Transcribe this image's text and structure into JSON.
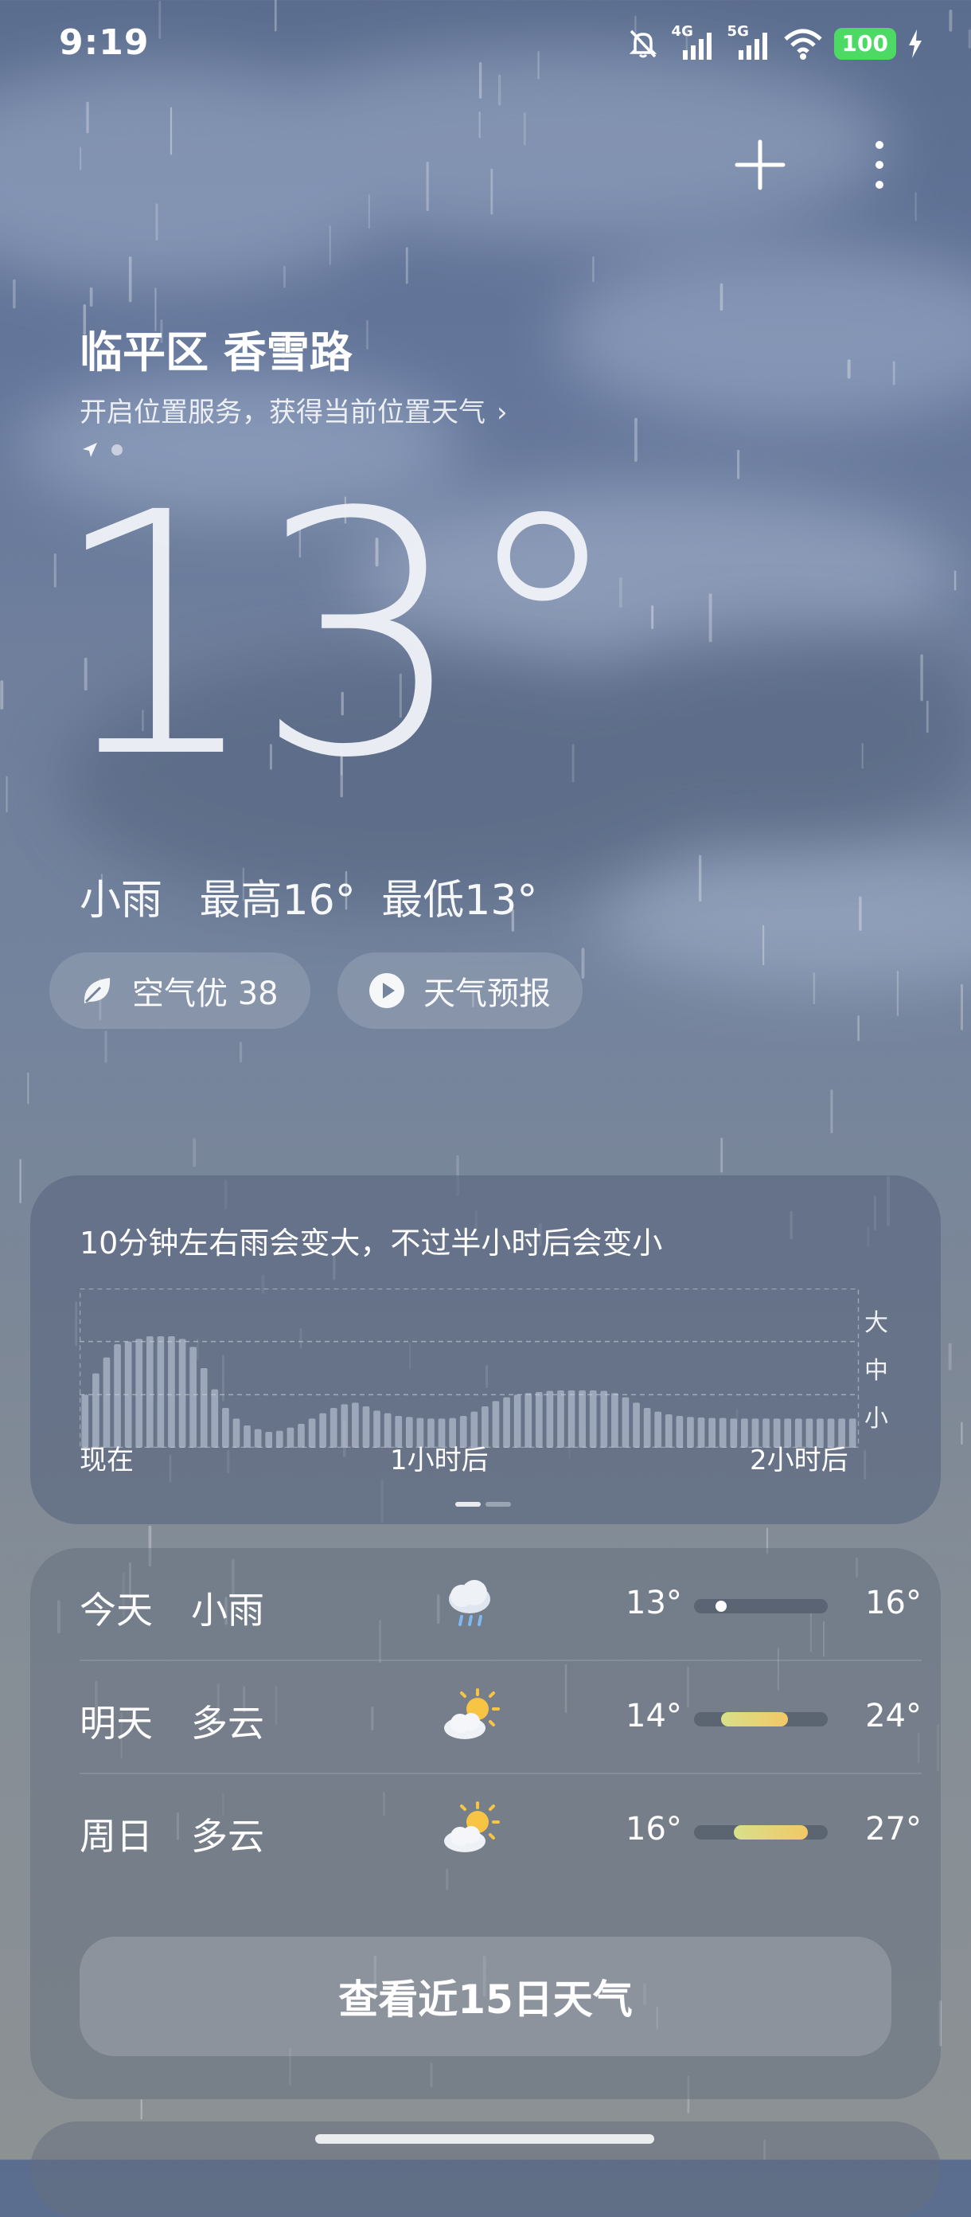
{
  "status_bar": {
    "time": "9:19",
    "net1": "4G",
    "net2": "5G",
    "battery": "100",
    "icons": [
      "mute-icon",
      "signal-icon",
      "wifi-icon",
      "battery-icon",
      "charging-icon"
    ]
  },
  "header": {
    "location": "临平区 香雪路",
    "location_hint": "开启位置服务，获得当前位置天气",
    "actions": [
      "add-city-icon",
      "more-icon"
    ]
  },
  "current": {
    "temperature": "13°",
    "condition": "小雨",
    "high": "最高16°",
    "low": "最低13°"
  },
  "pills": {
    "air": "空气优 38",
    "forecast": "天气预报"
  },
  "minute_rain": {
    "summary": "10分钟左右雨会变大，不过半小时后会变小",
    "x_labels": [
      "现在",
      "1小时后",
      "2小时后"
    ],
    "levels": [
      "大",
      "中",
      "小"
    ]
  },
  "chart_data": {
    "type": "bar",
    "ylim": [
      0,
      3
    ],
    "values": [
      1.0,
      1.4,
      1.7,
      1.95,
      2.0,
      2.05,
      2.1,
      2.1,
      2.1,
      2.05,
      1.9,
      1.5,
      1.1,
      0.75,
      0.55,
      0.42,
      0.35,
      0.3,
      0.32,
      0.38,
      0.45,
      0.55,
      0.65,
      0.75,
      0.82,
      0.85,
      0.78,
      0.7,
      0.65,
      0.6,
      0.58,
      0.56,
      0.55,
      0.55,
      0.56,
      0.6,
      0.68,
      0.78,
      0.88,
      0.95,
      1.0,
      1.03,
      1.05,
      1.07,
      1.08,
      1.08,
      1.08,
      1.08,
      1.07,
      1.03,
      0.95,
      0.85,
      0.75,
      0.68,
      0.63,
      0.6,
      0.58,
      0.57,
      0.56,
      0.56,
      0.55,
      0.55,
      0.55,
      0.55,
      0.55,
      0.55,
      0.55,
      0.55,
      0.55,
      0.55,
      0.55,
      0.55
    ]
  },
  "daily": [
    {
      "day": "今天",
      "condition": "小雨",
      "icon": "rain-cloud-icon",
      "low": "13°",
      "high": "16°",
      "range_low": 13,
      "range_high": 16
    },
    {
      "day": "明天",
      "condition": "多云",
      "icon": "partly-cloudy-icon",
      "low": "14°",
      "high": "24°",
      "range_low": 14,
      "range_high": 24
    },
    {
      "day": "周日",
      "condition": "多云",
      "icon": "partly-cloudy-icon",
      "low": "16°",
      "high": "27°",
      "range_low": 16,
      "range_high": 27
    }
  ],
  "daily_scale": [
    10,
    30
  ],
  "view15_label": "查看近15日天气"
}
